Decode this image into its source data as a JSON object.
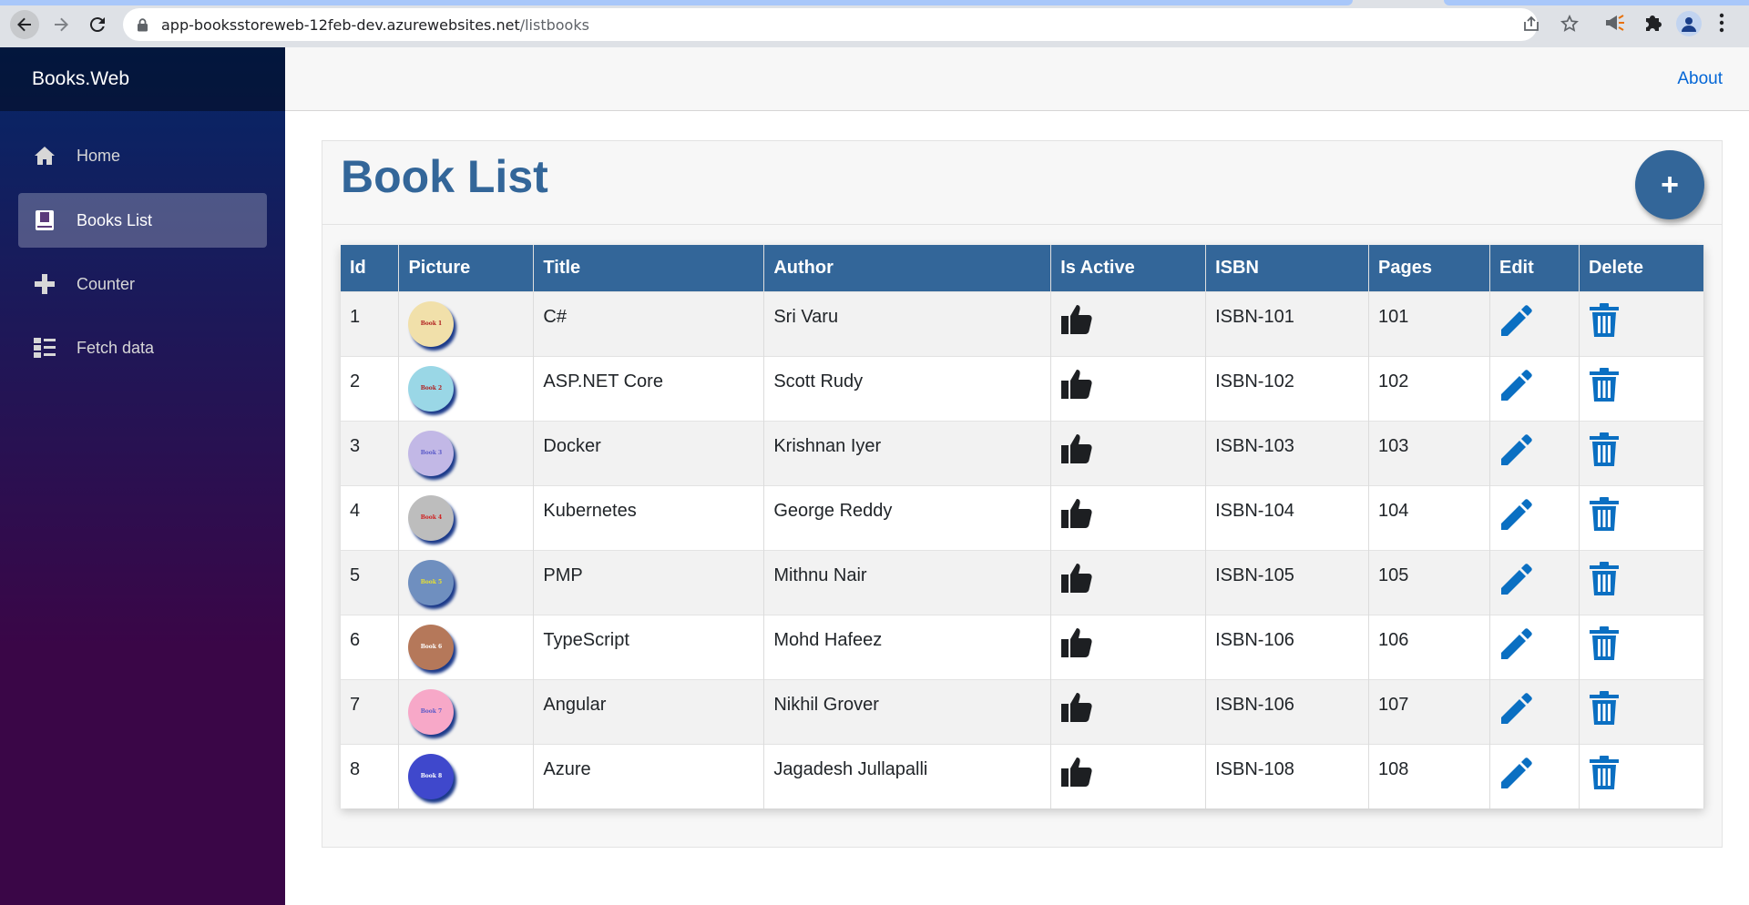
{
  "browser": {
    "url_host": "app-booksstoreweb-12feb-dev.azurewebsites.net",
    "url_path": "/listbooks"
  },
  "app": {
    "brand": "Books.Web",
    "about_link": "About"
  },
  "sidebar": {
    "items": [
      {
        "label": "Home",
        "icon": "home-icon"
      },
      {
        "label": "Books List",
        "icon": "book-icon",
        "active": true
      },
      {
        "label": "Counter",
        "icon": "plus-icon"
      },
      {
        "label": "Fetch data",
        "icon": "list-icon"
      }
    ]
  },
  "page": {
    "title": "Book List",
    "add_button": "+"
  },
  "colors": {
    "accent": "#336699",
    "icon_blue": "#0a6fc2"
  },
  "table": {
    "headers": [
      "Id",
      "Picture",
      "Title",
      "Author",
      "Is Active",
      "ISBN",
      "Pages",
      "Edit",
      "Delete"
    ],
    "rows": [
      {
        "id": "1",
        "picture": "Book 1",
        "pic_bg": "#f1e0aa",
        "pic_fg": "#b02020",
        "title": "C#",
        "author": "Sri Varu",
        "isbn": "ISBN-101",
        "pages": "101"
      },
      {
        "id": "2",
        "picture": "Book 2",
        "pic_bg": "#9ad7e6",
        "pic_fg": "#b02020",
        "title": "ASP.NET Core",
        "author": "Scott Rudy",
        "isbn": "ISBN-102",
        "pages": "102"
      },
      {
        "id": "3",
        "picture": "Book 3",
        "pic_bg": "#c2b8e6",
        "pic_fg": "#5a5ac8",
        "title": "Docker",
        "author": "Krishnan Iyer",
        "isbn": "ISBN-103",
        "pages": "103"
      },
      {
        "id": "4",
        "picture": "Book 4",
        "pic_bg": "#bdbdbd",
        "pic_fg": "#d02020",
        "title": "Kubernetes",
        "author": "George Reddy",
        "isbn": "ISBN-104",
        "pages": "104"
      },
      {
        "id": "5",
        "picture": "Book 5",
        "pic_bg": "#6f8fbf",
        "pic_fg": "#e8e030",
        "title": "PMP",
        "author": "Mithnu Nair",
        "isbn": "ISBN-105",
        "pages": "105"
      },
      {
        "id": "6",
        "picture": "Book 6",
        "pic_bg": "#b5785a",
        "pic_fg": "#ffffff",
        "title": "TypeScript",
        "author": "Mohd Hafeez",
        "isbn": "ISBN-106",
        "pages": "106"
      },
      {
        "id": "7",
        "picture": "Book 7",
        "pic_bg": "#f7a8c8",
        "pic_fg": "#5a5ac8",
        "title": "Angular",
        "author": "Nikhil Grover",
        "isbn": "ISBN-106",
        "pages": "107"
      },
      {
        "id": "8",
        "picture": "Book 8",
        "pic_bg": "#3f48cc",
        "pic_fg": "#ffffff",
        "title": "Azure",
        "author": "Jagadesh Jullapalli",
        "isbn": "ISBN-108",
        "pages": "108"
      }
    ]
  }
}
